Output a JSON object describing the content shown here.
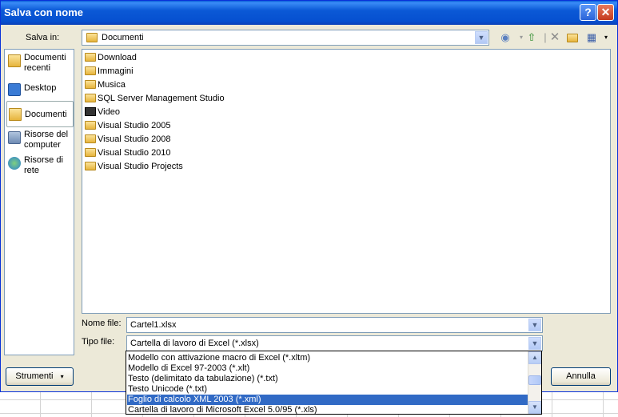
{
  "window": {
    "title": "Salva con nome",
    "help_button": "?",
    "close_button": "✕"
  },
  "save_in": {
    "label": "Salva in:",
    "value": "Documenti"
  },
  "places": [
    {
      "label": "Documenti recenti",
      "icon": "recent-documents-icon"
    },
    {
      "label": "Desktop",
      "icon": "desktop-icon"
    },
    {
      "label": "Documenti",
      "icon": "documents-icon",
      "selected": true
    },
    {
      "label": "Risorse del computer",
      "icon": "my-computer-icon"
    },
    {
      "label": "Risorse di rete",
      "icon": "network-icon"
    }
  ],
  "files": [
    {
      "name": "Download",
      "icon": "folder-icon"
    },
    {
      "name": "Immagini",
      "icon": "pictures-folder-icon"
    },
    {
      "name": "Musica",
      "icon": "music-folder-icon"
    },
    {
      "name": "SQL Server Management Studio",
      "icon": "folder-icon"
    },
    {
      "name": "Video",
      "icon": "video-folder-icon"
    },
    {
      "name": "Visual Studio 2005",
      "icon": "folder-icon"
    },
    {
      "name": "Visual Studio 2008",
      "icon": "folder-icon"
    },
    {
      "name": "Visual Studio 2010",
      "icon": "folder-icon"
    },
    {
      "name": "Visual Studio Projects",
      "icon": "folder-icon"
    }
  ],
  "filename": {
    "label": "Nome file:",
    "value": "Cartel1.xlsx"
  },
  "filetype": {
    "label": "Tipo file:",
    "value": "Cartella di lavoro di Excel (*.xlsx)",
    "options": [
      "Modello con attivazione macro di Excel (*.xltm)",
      "Modello di Excel 97-2003 (*.xlt)",
      "Testo (delimitato da tabulazione) (*.txt)",
      "Testo Unicode (*.txt)",
      "Foglio di calcolo XML 2003 (*.xml)",
      "Cartella di lavoro di Microsoft Excel 5.0/95 (*.xls)"
    ],
    "highlighted_index": 4
  },
  "buttons": {
    "tools": "Strumenti",
    "cancel": "Annulla"
  },
  "colors": {
    "titlebar": "#0b59d6",
    "highlight": "#316ac5",
    "dialog_bg": "#ece9d8"
  }
}
